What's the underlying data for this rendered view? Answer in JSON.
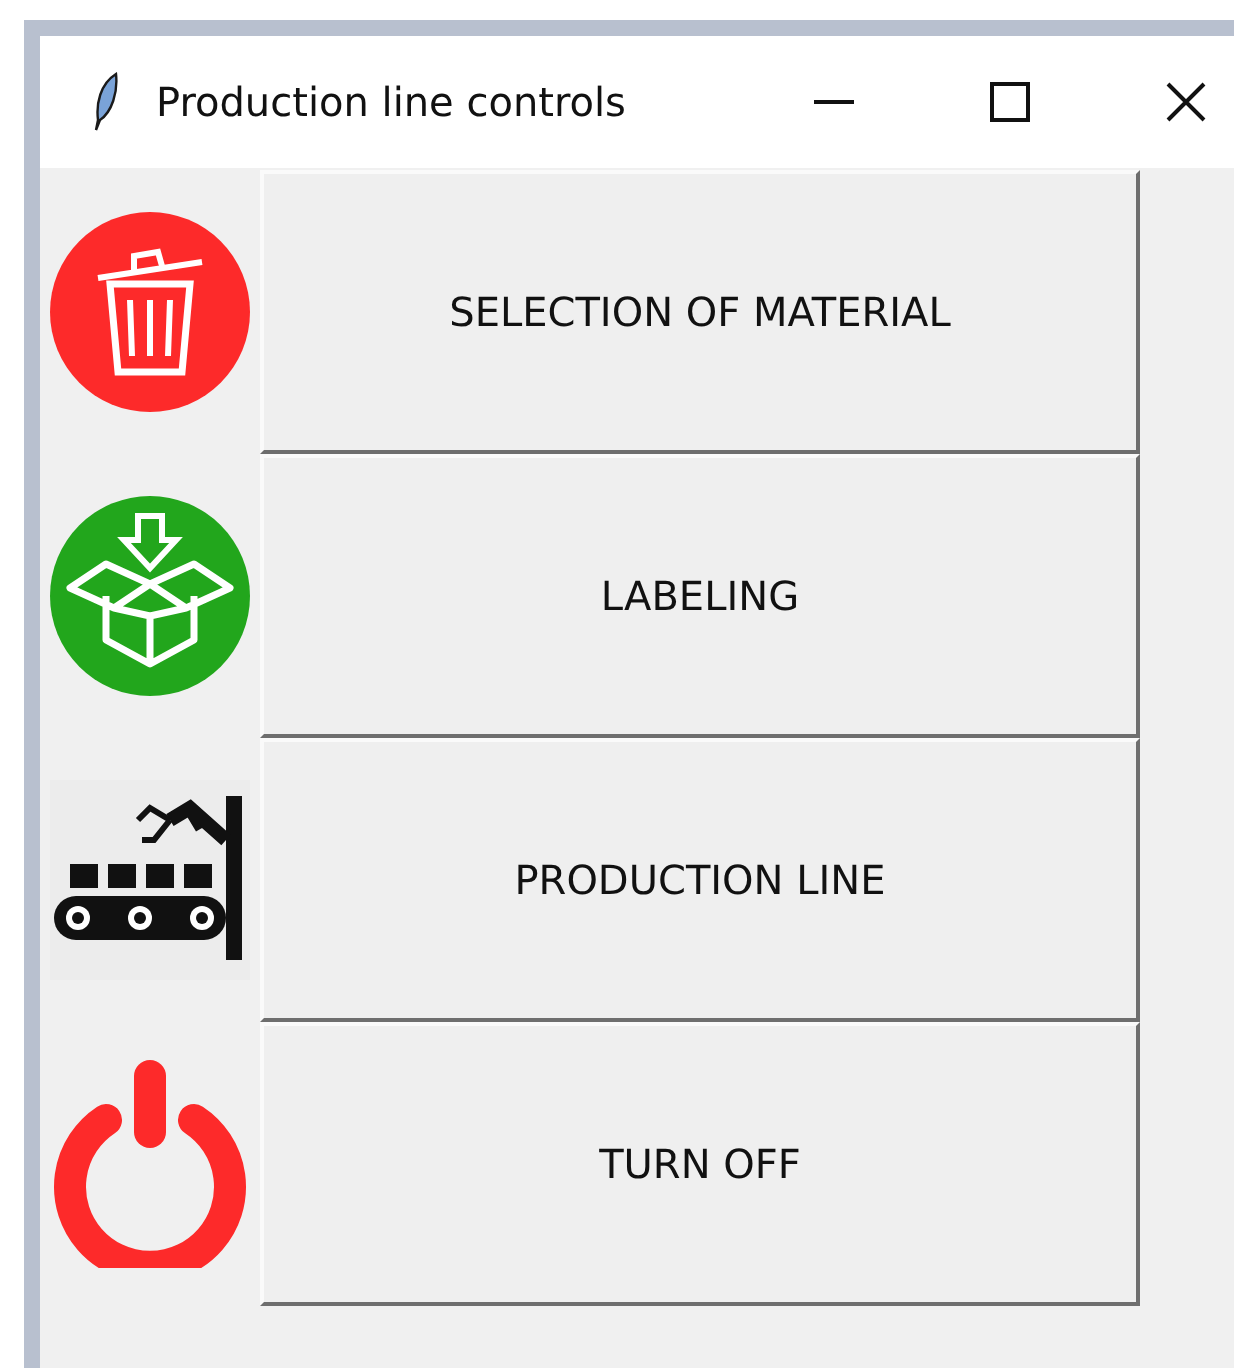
{
  "window": {
    "title": "Production line controls"
  },
  "buttons": [
    {
      "label": "SELECTION OF MATERIAL",
      "kind": "trash"
    },
    {
      "label": "LABELING",
      "kind": "box"
    },
    {
      "label": "PRODUCTION LINE",
      "kind": "conveyor"
    },
    {
      "label": "TURN OFF",
      "kind": "power"
    }
  ]
}
